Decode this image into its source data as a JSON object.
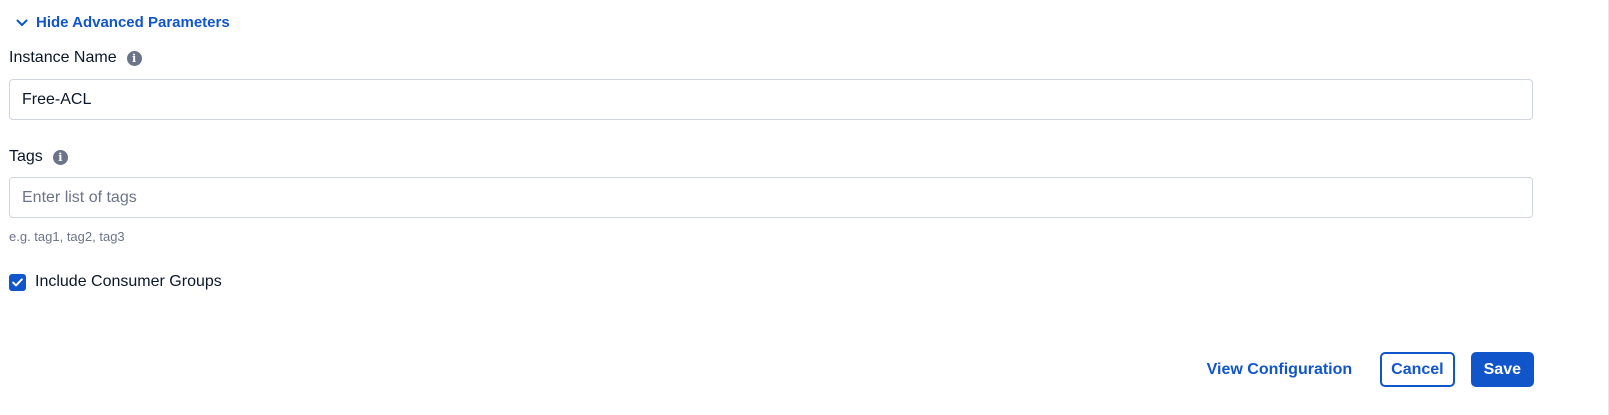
{
  "advanced_toggle": {
    "label": "Hide Advanced Parameters",
    "icon": "chevron-down-icon"
  },
  "instance_name": {
    "label": "Instance Name",
    "value": "Free-ACL",
    "info_icon": "info-icon"
  },
  "tags": {
    "label": "Tags",
    "placeholder": "Enter list of tags",
    "value": "",
    "help_text": "e.g. tag1, tag2, tag3",
    "info_icon": "info-icon"
  },
  "include_consumer_groups": {
    "label": "Include Consumer Groups",
    "checked": true
  },
  "actions": {
    "view_configuration": "View Configuration",
    "cancel": "Cancel",
    "save": "Save"
  },
  "colors": {
    "accent": "#1155cb",
    "text": "#0b172a",
    "muted": "#6c7489",
    "border": "#d0d5dd"
  }
}
